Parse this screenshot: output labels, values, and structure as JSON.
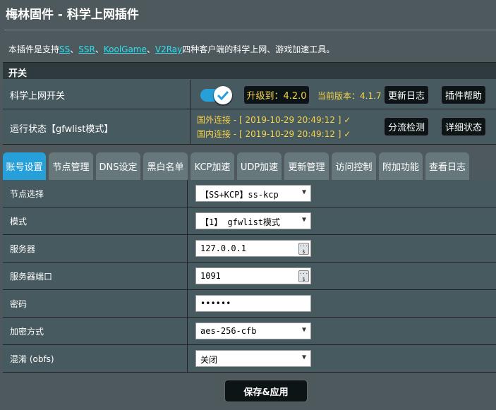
{
  "page": {
    "title": "梅林固件 - 科学上网插件",
    "desc_prefix": "本插件是支持",
    "links": [
      "SS",
      "SSR",
      "KoolGame",
      "V2Ray"
    ],
    "sep": "、",
    "desc_suffix": "四种客户端的科学上网、游戏加速工具。"
  },
  "switch_section": {
    "header": "开关"
  },
  "switch_row": {
    "label": "科学上网开关",
    "toggle_on": true,
    "upgrade_label": "升级到：4.2.0",
    "current_version": "当前版本：4.1.7",
    "changelog_button": "更新日志",
    "help_button": "插件帮助"
  },
  "status_row": {
    "label": "运行状态【gfwlist模式】",
    "foreign": "国外连接 - [ 2019-10-29 20:49:12 ] ✓",
    "domestic": "国内连接 - [ 2019-10-29 20:49:12 ] ✓",
    "split_check_button": "分流检测",
    "detail_button": "详细状态"
  },
  "tabs": [
    "账号设置",
    "节点管理",
    "DNS设定",
    "黑白名单",
    "KCP加速",
    "UDP加速",
    "更新管理",
    "访问控制",
    "附加功能",
    "查看日志"
  ],
  "active_tab": 0,
  "form": {
    "node_label": "节点选择",
    "node_value": "【SS+KCP】ss-kcp",
    "mode_label": "模式",
    "mode_value": "【1】 gfwlist模式",
    "server_label": "服务器",
    "server_value": "127.0.0.1",
    "port_label": "服务器端口",
    "port_value": "1091",
    "password_label": "密码",
    "password_value": "••••••",
    "cipher_label": "加密方式",
    "cipher_value": "aes-256-cfb",
    "obfs_label": "混淆 (obfs)",
    "obfs_value": "关闭"
  },
  "save_button": "保存&应用",
  "colors": {
    "accent": "#279fd9",
    "link": "#2de0f0",
    "warn": "#f5d24a",
    "bg": "#4d595d"
  }
}
